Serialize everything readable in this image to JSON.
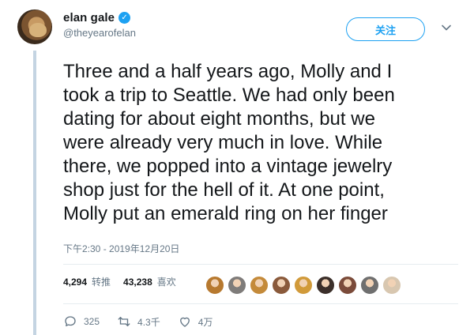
{
  "user": {
    "display_name": "elan gale",
    "handle": "@theyearofelan",
    "verified_icon": "verified-badge-icon"
  },
  "follow_button": {
    "label": "关注"
  },
  "tweet": {
    "text": "Three and a half years ago, Molly and I\ntook a trip to Seattle. We had only been\ndating for about eight months, but we\nwere already very much in love. While\nthere, we popped into a vintage jewelry\nshop just for the hell of it. At one point,\nMolly put an emerald ring on her finger",
    "timestamp": "下午2:30 - 2019年12月20日"
  },
  "stats": {
    "retweets_count": "4,294",
    "retweets_label": "转推",
    "likes_count": "43,238",
    "likes_label": "喜欢"
  },
  "likers": [
    {
      "color": "#b7792f"
    },
    {
      "color": "#7f7c7a"
    },
    {
      "color": "#c48a3a"
    },
    {
      "color": "#8a5a3b"
    },
    {
      "color": "#d19a3a"
    },
    {
      "color": "#3b2f2a"
    },
    {
      "color": "#7b4b3a"
    },
    {
      "color": "#6f6f6f"
    },
    {
      "color": "#d8c7b0"
    }
  ],
  "actions": {
    "reply_count": "325",
    "retweet_count": "4.3千",
    "like_count": "4万"
  },
  "colors": {
    "accent": "#1da1f2",
    "secondary_text": "#657786",
    "thread_line": "#c4d4e2"
  }
}
